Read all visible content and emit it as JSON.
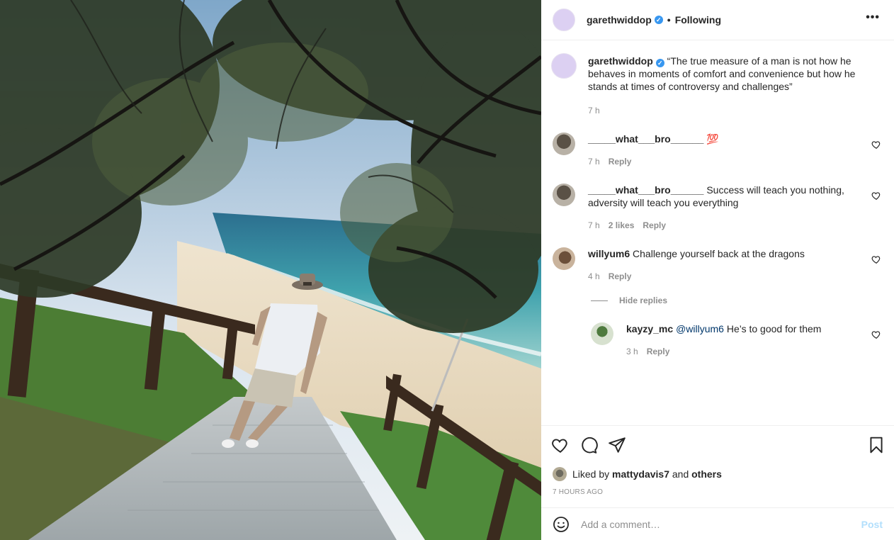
{
  "post": {
    "author": "garethwiddop",
    "follow_status": "Following",
    "more_glyph": "•••"
  },
  "caption": {
    "author": "garethwiddop",
    "text": "“The true measure of a man is not how he behaves in moments of comfort and convenience but how he stands at times of controversy and challenges”",
    "time": "7 h"
  },
  "comments": [
    {
      "author": "_____what___bro______",
      "text": "💯",
      "time": "7 h",
      "likes": "",
      "reply_label": "Reply"
    },
    {
      "author": "_____what___bro______",
      "text": "Success will teach you nothing, adversity will teach you everything",
      "time": "7 h",
      "likes": "2 likes",
      "reply_label": "Reply"
    },
    {
      "author": "willyum6",
      "text": "Challenge yourself back at the dragons",
      "time": "4 h",
      "likes": "",
      "reply_label": "Reply"
    }
  ],
  "hide_replies_label": "Hide replies",
  "reply": {
    "author": "kayzy_mc",
    "mention": "@willyum6",
    "text": "He’s to good for them",
    "time": "3 h",
    "reply_label": "Reply"
  },
  "likes": {
    "prefix": "Liked by",
    "user": "mattydavis7",
    "mid": "and",
    "others": "others"
  },
  "time_ago": "7 HOURS AGO",
  "composer": {
    "placeholder": "Add a comment…",
    "post_label": "Post"
  },
  "icons": {
    "verified": "verified-badge-icon",
    "like": "heart-icon",
    "comment": "comment-icon",
    "share": "share-icon",
    "save": "bookmark-icon",
    "emoji": "emoji-icon"
  }
}
